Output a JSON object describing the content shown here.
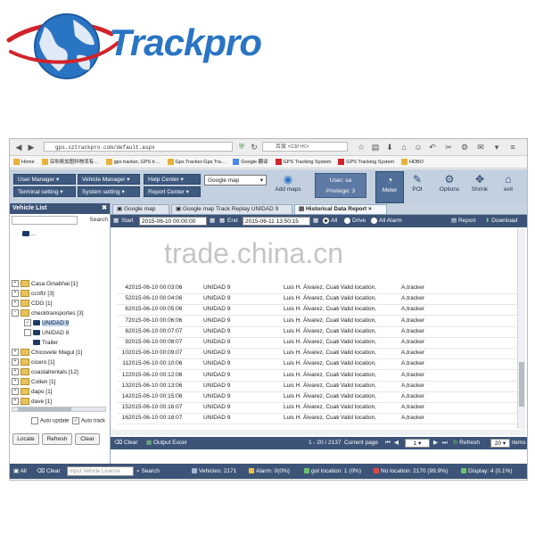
{
  "brand": {
    "name": "Trackpro"
  },
  "browser": {
    "url": "gps.sztrackpro.com/default.aspx",
    "search_placeholder": "百度 <Ctrl+K>",
    "bookmarks": [
      "Home",
      "深圳奥加图科物流有…",
      "gps tracker, GPS tr…",
      "Gps Tracker-Gps Tra…",
      "Google 翻译",
      "GPS Tracking System",
      "GPS Tracking System",
      "HDBO"
    ]
  },
  "toolbar": {
    "user_manager": "User Manager",
    "vehicle_manager": "Vehicle Manager",
    "help_center": "Help Center",
    "terminal_setting": "Terminal setting",
    "system_setting": "System setting",
    "report_center": "Report Center",
    "map_select": "Google map",
    "add_maps": "Add maps",
    "user": "User: sa",
    "privilege": "Privilege: 3",
    "meter": "Meter",
    "poi": "POI",
    "options": "Options",
    "shrink": "Shrink",
    "exit": "exit"
  },
  "left": {
    "title": "Vehicle List",
    "search": "Search",
    "tree": [
      {
        "label": "Casa Ginabhai [1]",
        "kind": "group"
      },
      {
        "label": "ccnflz [3]",
        "kind": "group"
      },
      {
        "label": "CDG [1]",
        "kind": "group"
      },
      {
        "label": "checktransportes [3]",
        "kind": "group"
      },
      {
        "label": "UNIDAD 9",
        "kind": "vehicle",
        "selected": true
      },
      {
        "label": "UNIDAD 8",
        "kind": "vehicle"
      },
      {
        "label": "Trailer",
        "kind": "vehicle"
      },
      {
        "label": "Chicovete Magul [1]",
        "kind": "group"
      },
      {
        "label": "cicero [1]",
        "kind": "group"
      },
      {
        "label": "coastalrentals [12]",
        "kind": "group"
      },
      {
        "label": "Collen [1]",
        "kind": "group"
      },
      {
        "label": "dapo [1]",
        "kind": "group"
      },
      {
        "label": "dave [1]",
        "kind": "group"
      }
    ],
    "auto_update": "Auto update",
    "auto_track": "Auto track",
    "locate": "Locate",
    "refresh": "Refresh",
    "clear": "Clear"
  },
  "tabs": [
    {
      "label": "Google map",
      "active": false
    },
    {
      "label": "Google map Track Replay UNIDAD 9",
      "active": false
    },
    {
      "label": "Historical Data Report",
      "active": true
    }
  ],
  "filter": {
    "start_label": "Start",
    "start_value": "2015-06-10 00:00:00",
    "end_label": "End",
    "end_value": "2015-06-11 13:50:15",
    "all": "All",
    "drive": "Drive",
    "all_alarm": "All Alarm",
    "report": "Report",
    "download": "Download"
  },
  "watermark": "trade.china.cn",
  "table": {
    "rows": [
      [
        "4",
        "2015-06-10 00:03:06",
        "UNIDAD 9",
        "Luis H. Álvarez, Cuatro ...",
        "Valid location,",
        "A,tracker"
      ],
      [
        "5",
        "2015-06-10 00:04:06",
        "UNIDAD 9",
        "Luis H. Álvarez, Cuatro ...",
        "Valid location,",
        "A,tracker"
      ],
      [
        "6",
        "2015-06-10 00:05:06",
        "UNIDAD 9",
        "Luis H. Álvarez, Cuatro ...",
        "Valid location,",
        "A,tracker"
      ],
      [
        "7",
        "2015-06-10 00:06:06",
        "UNIDAD 9",
        "Luis H. Álvarez, Cuatro ...",
        "Valid location,",
        "A,tracker"
      ],
      [
        "8",
        "2015-06-10 00:07:07",
        "UNIDAD 9",
        "Luis H. Álvarez, Cuatro ...",
        "Valid location,",
        "A,tracker"
      ],
      [
        "9",
        "2015-06-10 00:08:07",
        "UNIDAD 9",
        "Luis H. Álvarez, Cuatro ...",
        "Valid location,",
        "A,tracker"
      ],
      [
        "10",
        "2015-06-10 00:09:07",
        "UNIDAD 9",
        "Luis H. Álvarez, Cuatro ...",
        "Valid location,",
        "A,tracker"
      ],
      [
        "11",
        "2015-06-10 00:10:06",
        "UNIDAD 9",
        "Luis H. Álvarez, Cuatro ...",
        "Valid location,",
        "A,tracker"
      ],
      [
        "12",
        "2015-06-10 00:12:06",
        "UNIDAD 9",
        "Luis H. Álvarez, Cuatro ...",
        "Valid location,",
        "A,tracker"
      ],
      [
        "13",
        "2015-06-10 00:13:06",
        "UNIDAD 9",
        "Luis H. Álvarez, Cuatro ...",
        "Valid location,",
        "A,tracker"
      ],
      [
        "14",
        "2015-06-10 00:15:06",
        "UNIDAD 9",
        "Luis H. Álvarez, Cuatro ...",
        "Valid location,",
        "A,tracker"
      ],
      [
        "15",
        "2015-06-10 00:16:07",
        "UNIDAD 9",
        "Luis H. Álvarez, Cuatro ...",
        "Valid location,",
        "A,tracker"
      ],
      [
        "16",
        "2015-06-10 00:18:07",
        "UNIDAD 9",
        "Luis H. Álvarez, Cuatro ...",
        "Valid location,",
        "A,tracker"
      ]
    ]
  },
  "pager": {
    "clear": "Clear",
    "output_excel": "Output Excel",
    "range": "1 - 20 / 2137",
    "current_page_label": "Current page",
    "page": "1",
    "refresh": "Refresh",
    "page_size": "20",
    "items": "items"
  },
  "status": {
    "all": "All",
    "clear": "Clear",
    "input_placeholder": "Input Vehicle License",
    "search": "Search",
    "vehicles": "Vehicles: 2171",
    "alarm": "Alarm: 0(0%)",
    "got_location": "got location: 1 (0%)",
    "no_location": "No location: 2170 (99.9%)",
    "display": "Display: 4 (0.1%)"
  },
  "colors": {
    "brand_blue": "#2a74c4",
    "panel_navy": "#3d5478",
    "logo_red": "#d2232a"
  }
}
